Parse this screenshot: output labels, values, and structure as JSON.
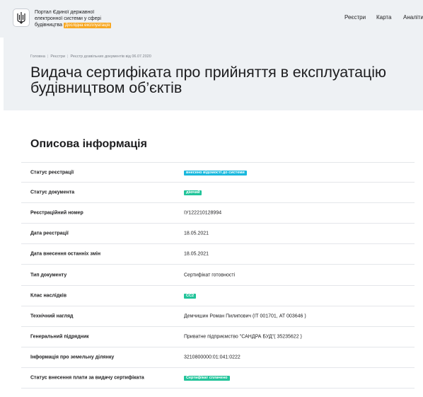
{
  "colors": {
    "header_bg": "#eef1f4",
    "beta_badge": "#f7a823",
    "status_blue": "#19b8dd",
    "status_green": "#22c49a"
  },
  "header": {
    "logo_icon": "trident-icon",
    "portal_line1": "Портал Єдиної державної",
    "portal_line2": "електронної системи у сфері",
    "portal_line3": "будівництва",
    "beta_badge": "Дослідна експлуатація",
    "nav": [
      "Реєстри",
      "Карта",
      "Аналіти"
    ]
  },
  "breadcrumb": [
    "Головна",
    "Реєстри",
    "Реєстр дозвільних документів від 06.07.2020"
  ],
  "page_title": "Видача сертифіката про прийняття в експлуатацію будівництвом об’єктів",
  "section_title": "Описова інформація",
  "rows": [
    {
      "label": "Статус реєстрації",
      "value": "внесено відомості до системи",
      "badge": "blue"
    },
    {
      "label": "Статус документа",
      "value": "діючий",
      "badge": "green"
    },
    {
      "label": "Реєстраційний номер",
      "value": "ІУ122210128994"
    },
    {
      "label": "Дата реєстрації",
      "value": "18.05.2021"
    },
    {
      "label": "Дата внесення останніх змін",
      "value": "18.05.2021"
    },
    {
      "label": "Тип документу",
      "value": "Сертифікат готовності"
    },
    {
      "label": "Клас наслідків",
      "value": "СС2",
      "badge": "green"
    },
    {
      "label": "Технічний нагляд",
      "value": "Демчишин Роман Пилипович (ІТ 001701, АТ 003646 )"
    },
    {
      "label": "Генеральний підрядник",
      "value": "Приватне підприємство \"САНДРА БУД\"( 35235622 )"
    },
    {
      "label": "Інформація про земельну ділянку",
      "value": "3210800000:01:041:0222"
    },
    {
      "label": "Статус внесення плати за видачу сертифіката",
      "value": "Сертифікат сплачено",
      "badge": "green"
    }
  ]
}
